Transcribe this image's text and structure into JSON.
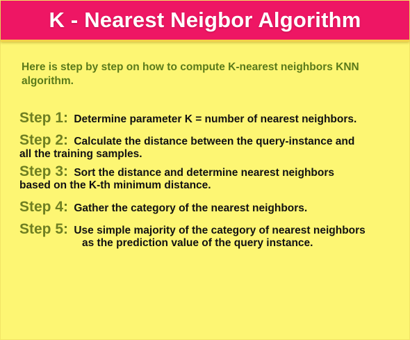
{
  "title": "K - Nearest Neigbor Algorithm",
  "intro": "Here is step by step on how to compute K-nearest neighbors KNN algorithm.",
  "steps": [
    {
      "label": "Step 1:",
      "line1": "Determine parameter K = number of nearest neighbors.",
      "line2": ""
    },
    {
      "label": "Step 2:",
      "line1": "Calculate the distance between the query-instance and",
      "line2": "all the training samples."
    },
    {
      "label": "Step 3:",
      "line1": "Sort the distance and determine nearest neighbors",
      "line2": "based on the K-th minimum distance."
    },
    {
      "label": "Step 4:",
      "line1": "Gather the category of the nearest neighbors.",
      "line2": ""
    },
    {
      "label": "Step 5:",
      "line1": "Use simple majority of the category of nearest neighbors",
      "line2": "as the prediction value of the query instance."
    }
  ],
  "colors": {
    "header": "#ee1664",
    "background": "#fdf673",
    "step_label": "#6f7f22",
    "intro_text": "#5a7a1a"
  }
}
